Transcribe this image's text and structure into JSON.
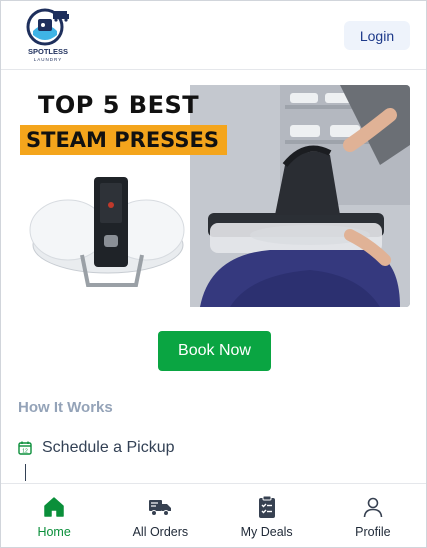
{
  "header": {
    "logo_text": "SPOTLESS",
    "logo_subtext": "LAUNDRY",
    "login_label": "Login"
  },
  "banner": {
    "line1": "TOP 5 BEST",
    "line2": "STEAM PRESSES"
  },
  "main": {
    "book_label": "Book Now",
    "how_title": "How It Works",
    "steps": [
      {
        "label": "Schedule a Pickup",
        "icon": "calendar-icon"
      }
    ]
  },
  "nav": {
    "items": [
      {
        "label": "Home",
        "icon": "home-icon",
        "active": true
      },
      {
        "label": "All Orders",
        "icon": "truck-icon",
        "active": false
      },
      {
        "label": "My Deals",
        "icon": "clipboard-icon",
        "active": false
      },
      {
        "label": "Profile",
        "icon": "user-icon",
        "active": false
      }
    ]
  },
  "colors": {
    "primary_green": "#0aa542",
    "login_bg": "#eef3fb",
    "banner_accent": "#f4a51c",
    "muted_heading": "#94a3b8"
  }
}
